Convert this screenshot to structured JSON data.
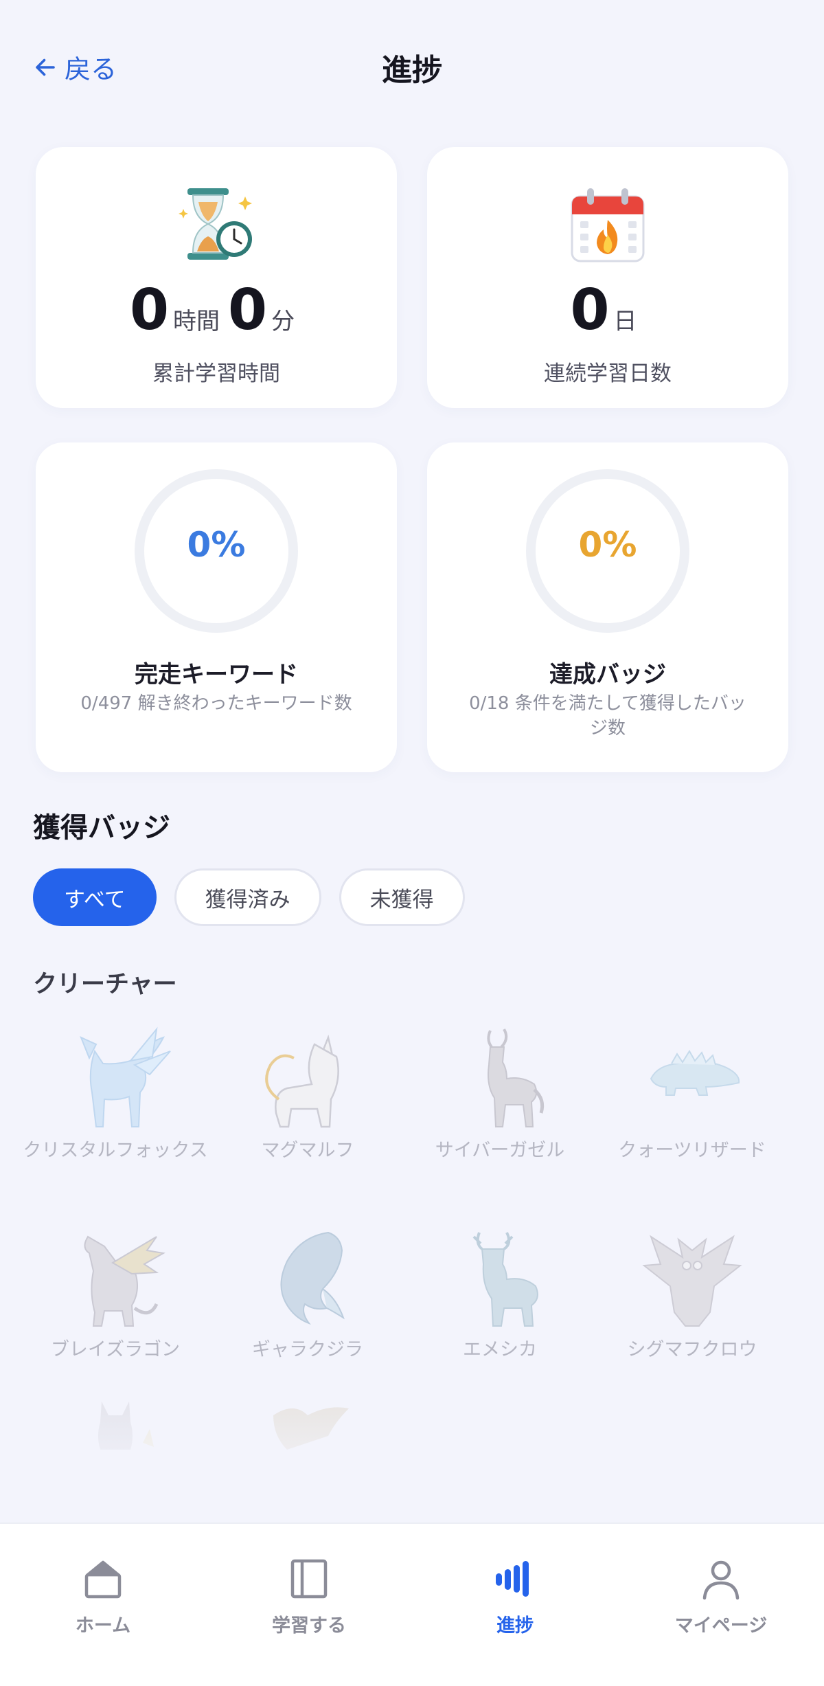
{
  "header": {
    "back_label": "戻る",
    "title": "進捗"
  },
  "stats": {
    "study_time": {
      "hours": "0",
      "hours_unit": "時間",
      "minutes": "0",
      "minutes_unit": "分",
      "label": "累計学習時間"
    },
    "streak": {
      "days": "0",
      "days_unit": "日",
      "label": "連続学習日数"
    }
  },
  "progress": {
    "keywords": {
      "percent_text": "0%",
      "percent": 0,
      "title": "完走キーワード",
      "subtitle": "0/497 解き終わったキーワード数",
      "color": "#3b7be0"
    },
    "badges": {
      "percent_text": "0%",
      "percent": 0,
      "title": "達成バッジ",
      "subtitle": "0/18 条件を満たして獲得したバッジ数",
      "color": "#e8a530"
    }
  },
  "badges_section": {
    "title": "獲得バッジ",
    "filters": [
      "すべて",
      "獲得済み",
      "未獲得"
    ],
    "active_filter": "すべて",
    "category": "クリーチャー",
    "items": [
      {
        "name": "クリスタルフォックス",
        "icon": "crystal-fox-icon"
      },
      {
        "name": "マグマルフ",
        "icon": "magma-wolf-icon"
      },
      {
        "name": "サイバーガゼル",
        "icon": "cyber-gazelle-icon"
      },
      {
        "name": "クォーツリザード",
        "icon": "quartz-lizard-icon"
      },
      {
        "name": "ブレイズラゴン",
        "icon": "blaze-dragon-icon"
      },
      {
        "name": "ギャラクジラ",
        "icon": "galaxy-whale-icon"
      },
      {
        "name": "エメシカ",
        "icon": "emerald-deer-icon"
      },
      {
        "name": "シグマフクロウ",
        "icon": "sigma-owl-icon"
      },
      {
        "name": "",
        "icon": "cat-creature-icon"
      },
      {
        "name": "",
        "icon": "dragon-creature-icon"
      }
    ]
  },
  "tabbar": {
    "items": [
      {
        "label": "ホーム",
        "icon": "home-icon"
      },
      {
        "label": "学習する",
        "icon": "book-icon"
      },
      {
        "label": "進捗",
        "icon": "progress-bars-icon"
      },
      {
        "label": "マイページ",
        "icon": "person-icon"
      }
    ],
    "active": "進捗"
  }
}
